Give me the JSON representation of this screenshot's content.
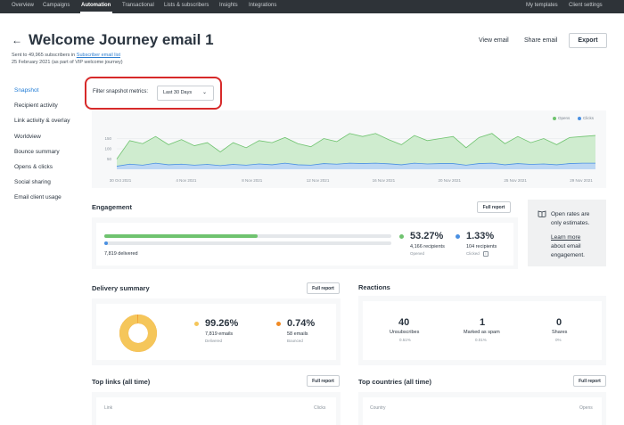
{
  "nav": {
    "items": [
      "Overview",
      "Campaigns",
      "Automation",
      "Transactional",
      "Lists & subscribers",
      "Insights",
      "Integrations"
    ],
    "right": [
      "My templates",
      "Client settings"
    ]
  },
  "header": {
    "title": "Welcome Journey email 1",
    "sub1_prefix": "Sent to 49,965 subscribers in",
    "sub1_link": "Subscriber email list",
    "sub2": "25 February 2021 (as part of VIP welcome journey)",
    "view_email": "View email",
    "share_email": "Share email",
    "export": "Export"
  },
  "sidebar": {
    "items": [
      "Snapshot",
      "Recipient activity",
      "Link activity & overlay",
      "Worldview",
      "Bounce summary",
      "Opens & clicks",
      "Social sharing",
      "Email client usage"
    ]
  },
  "filter": {
    "label": "Filter snapshot metrics:",
    "selected": "Last 30 Days"
  },
  "colors": {
    "opens": "#6fc36f",
    "clicks": "#4a90e2",
    "accent": "#1f7bd6",
    "highlight": "#d72a2a",
    "donut": "#f5c65a",
    "bounce": "#f08a24"
  },
  "chart_data": {
    "type": "area",
    "x": [
      "30 Oct 2021",
      "2 Nov 2021",
      "5 Nov 2021",
      "8 Nov 2021",
      "11 Nov 2021",
      "14 Nov 2021",
      "17 Nov 2021",
      "20 Nov 2021",
      "23 Nov 2021",
      "26 Nov 2021",
      "29 Nov 2021"
    ],
    "x_tick_labels": [
      "30 Oct 2021",
      "4 Nov 2021",
      "8 Nov 2021",
      "12 Nov 2021",
      "16 Nov 2021",
      "20 Nov 2021",
      "25 Nov 2021",
      "29 Nov 2021"
    ],
    "y_tick_labels": [
      "150",
      "100",
      "50"
    ],
    "ylim": [
      0,
      200
    ],
    "grid": true,
    "legend_position": "top-right",
    "series": [
      {
        "name": "Opens",
        "values": [
          50,
          140,
          125,
          160,
          120,
          145,
          115,
          130,
          85,
          130,
          105,
          140,
          130,
          155,
          125,
          110,
          150,
          135,
          175,
          160,
          175,
          145,
          120,
          165,
          140,
          150,
          160,
          105,
          155,
          175,
          125,
          160,
          130,
          150,
          120,
          155,
          160,
          165
        ]
      },
      {
        "name": "Clicks",
        "values": [
          15,
          25,
          20,
          30,
          22,
          25,
          20,
          24,
          18,
          24,
          20,
          26,
          22,
          30,
          22,
          20,
          28,
          25,
          30,
          28,
          30,
          27,
          22,
          30,
          26,
          28,
          28,
          20,
          28,
          30,
          22,
          28,
          24,
          26,
          22,
          28,
          30,
          30
        ]
      }
    ]
  },
  "engagement": {
    "title": "Engagement",
    "full_report": "Full report",
    "delivered": "7,819 delivered",
    "opened_fraction": 0.5327,
    "clicked_fraction": 0.0133,
    "opened_pct": "53.27%",
    "opened_sub": "4,166 recipients",
    "opened_label": "Opened",
    "clicked_pct": "1.33%",
    "clicked_sub": "104 recipients",
    "clicked_label": "Clicked"
  },
  "note": {
    "line1": "Open rates are",
    "line2": "only estimates.",
    "link1": "Learn more",
    "line3": "about email",
    "line4": "engagement."
  },
  "delivery": {
    "title": "Delivery summary",
    "full_report": "Full report",
    "delivered_pct": "99.26%",
    "delivered_sub": "7,819 emails",
    "delivered_label": "Delivered",
    "delivered_fraction": 0.9926,
    "bounced_pct": "0.74%",
    "bounced_sub": "58 emails",
    "bounced_label": "Bounced"
  },
  "reactions": {
    "title": "Reactions",
    "items": [
      {
        "value": "40",
        "label": "Unsubscribes",
        "pct": "0.51%"
      },
      {
        "value": "1",
        "label": "Marked as spam",
        "pct": "0.01%"
      },
      {
        "value": "0",
        "label": "Shares",
        "pct": "0%"
      }
    ]
  },
  "top_links": {
    "title": "Top links (all time)",
    "full_report": "Full report",
    "col1": "Link",
    "col2": "Clicks"
  },
  "top_countries": {
    "title": "Top countries (all time)",
    "full_report": "Full report",
    "col1": "Country",
    "col2": "Opens"
  }
}
